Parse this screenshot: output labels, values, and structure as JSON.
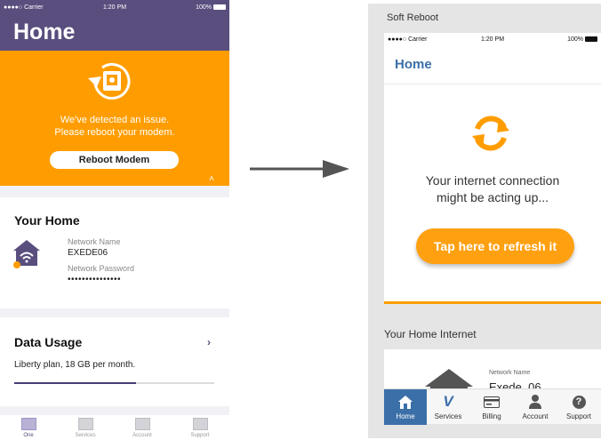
{
  "left_phone": {
    "status": {
      "carrier": "●●●●○ Carrier",
      "time": "1:20 PM",
      "battery": "100%"
    },
    "header_title": "Home",
    "alert": {
      "line1": "We've detected an issue.",
      "line2": "Please reboot your modem.",
      "button_label": "Reboot Modem",
      "caret": "˄"
    },
    "your_home": {
      "title": "Your Home",
      "network_name_label": "Network Name",
      "network_name_value": "EXEDE06",
      "network_password_label": "Network Password",
      "network_password_value": "•••••••••••••••"
    },
    "data_usage": {
      "title": "Data Usage",
      "chevron": "›",
      "plan_text": "Liberty plan, 18 GB per month.",
      "usage_fraction": 0.61
    },
    "tabs": [
      {
        "label": "One",
        "active": true
      },
      {
        "label": "Services",
        "active": false
      },
      {
        "label": "Account",
        "active": false
      },
      {
        "label": "Support",
        "active": false
      }
    ]
  },
  "right_phone": {
    "caption": "Soft Reboot",
    "status": {
      "carrier": "●●●●○ Carrier",
      "time": "1:20 PM",
      "battery": "100%"
    },
    "header_title": "Home",
    "message_line1": "Your internet connection",
    "message_line2": "might be acting up...",
    "refresh_button_label": "Tap here to refresh it",
    "section_title": "Your Home Internet",
    "network_name_label": "Network Name",
    "network_name_value": "Exede_06",
    "tabs": [
      {
        "label": "Home",
        "icon": "home-icon",
        "active": true
      },
      {
        "label": "Services",
        "icon": "services-v-icon",
        "active": false
      },
      {
        "label": "Billing",
        "icon": "billing-card-icon",
        "active": false
      },
      {
        "label": "Account",
        "icon": "account-person-icon",
        "active": false
      },
      {
        "label": "Support",
        "icon": "support-question-icon",
        "active": false
      }
    ]
  },
  "colors": {
    "purple": "#5a4e7e",
    "orange": "#ff9d00",
    "blue": "#3b6fa8"
  }
}
